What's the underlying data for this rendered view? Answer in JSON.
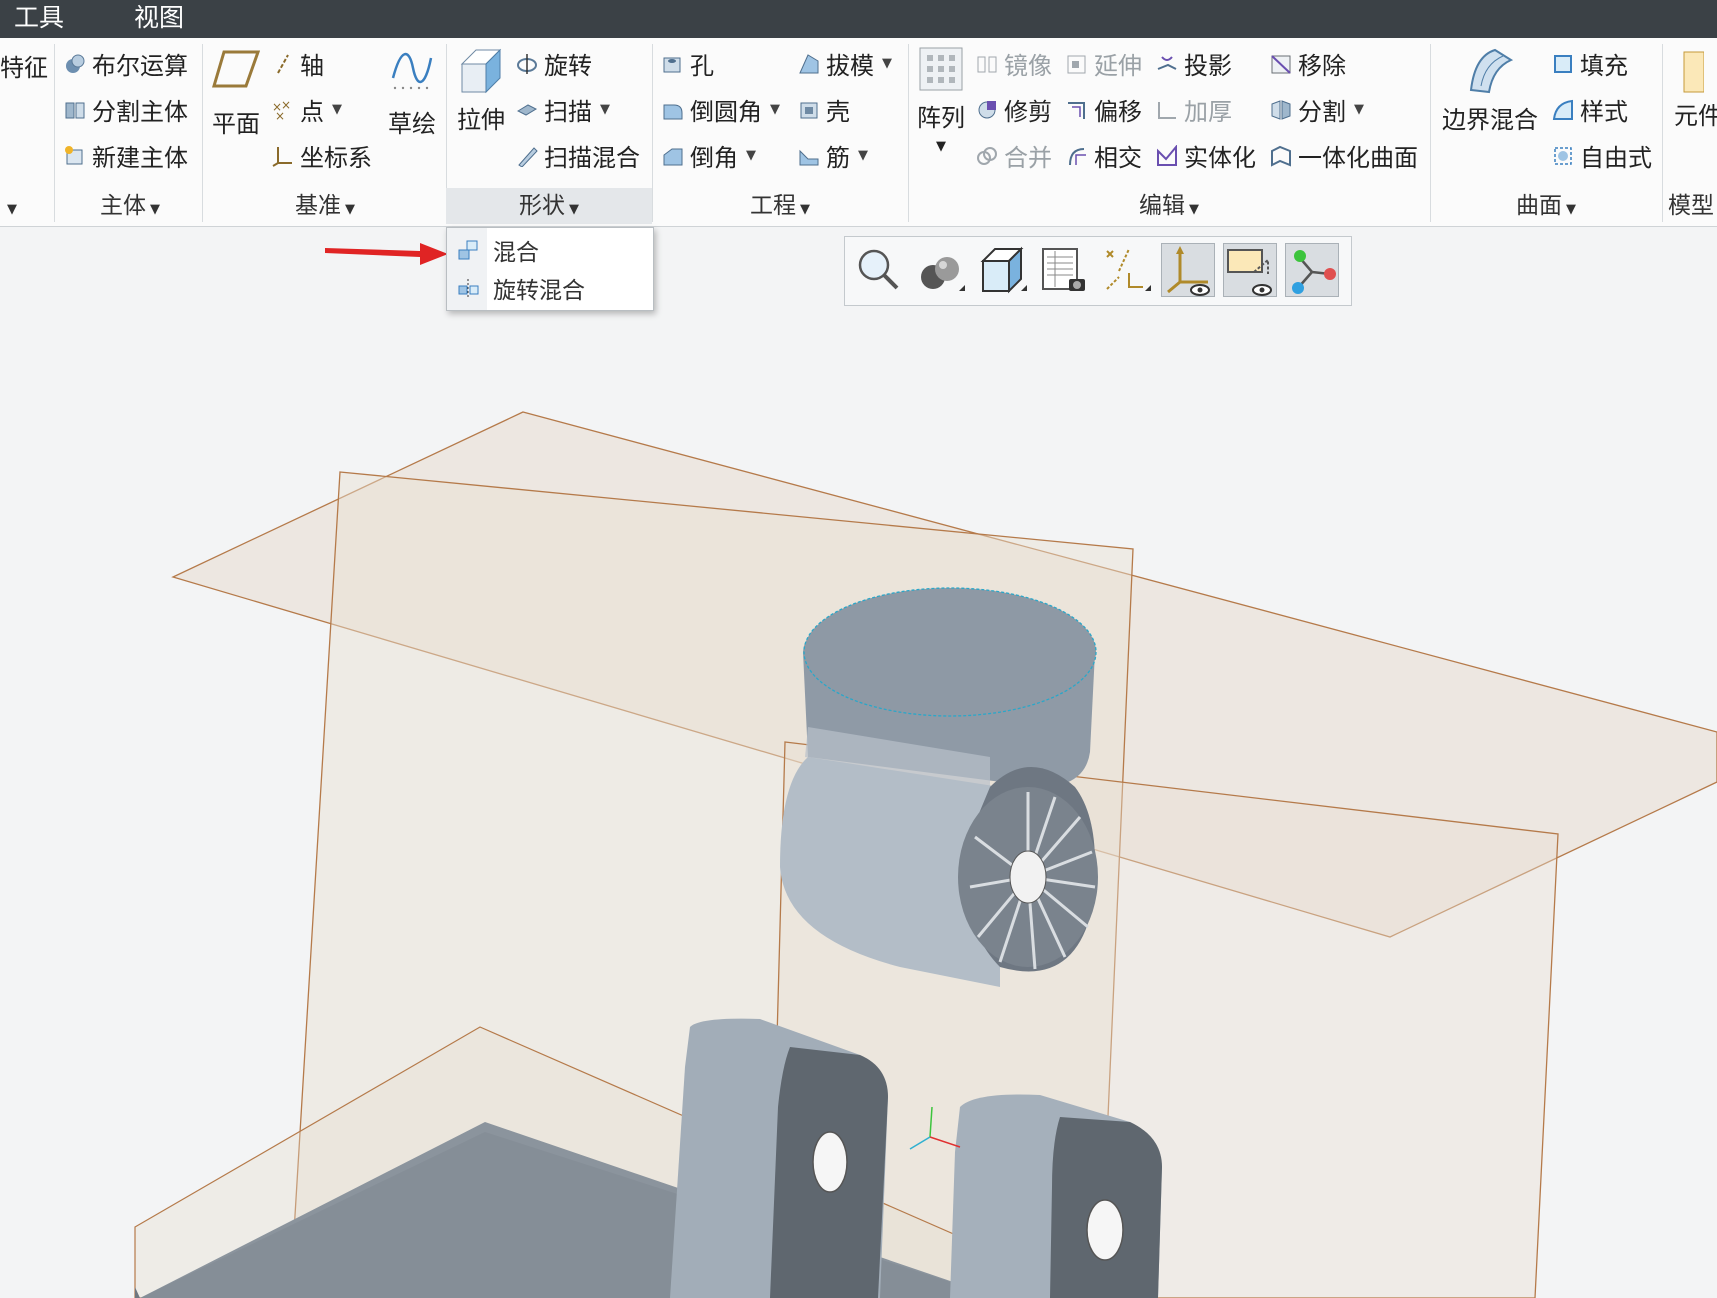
{
  "menubar": {
    "tools": "工具",
    "view": "视图"
  },
  "ribbon": {
    "feature_cut": "特征",
    "main_body": {
      "boolean": "布尔运算",
      "split_body": "分割主体",
      "new_body": "新建主体",
      "label": "主体"
    },
    "datum": {
      "plane": "平面",
      "axis": "轴",
      "point": "点",
      "csys": "坐标系",
      "sketch": "草绘",
      "label": "基准"
    },
    "shape": {
      "extrude": "拉伸",
      "revolve": "旋转",
      "sweep": "扫描",
      "swept_blend": "扫描混合",
      "label": "形状"
    },
    "engineering": {
      "hole": "孔",
      "draft": "拔模",
      "round": "倒圆角",
      "shell": "壳",
      "chamfer": "倒角",
      "rib": "筋",
      "label": "工程"
    },
    "editing": {
      "pattern": "阵列",
      "mirror": "镜像",
      "extend": "延伸",
      "project": "投影",
      "remove": "移除",
      "trim": "修剪",
      "offset": "偏移",
      "thicken": "加厚",
      "split": "分割",
      "merge": "合并",
      "intersect": "相交",
      "solidify": "实体化",
      "unify_surface": "一体化曲面",
      "label": "编辑"
    },
    "surface": {
      "boundary_blend": "边界混合",
      "fill": "填充",
      "style": "样式",
      "freestyle": "自由式",
      "label": "曲面"
    },
    "model_cut": {
      "component": "元件",
      "label": "模型"
    }
  },
  "shape_dropdown": {
    "items": [
      "混合",
      "旋转混合"
    ]
  },
  "colors": {
    "menubar": "#3b4146",
    "datum_plane": "#b57a4a",
    "solid": "#8a949f",
    "arrow": "#e02424"
  }
}
